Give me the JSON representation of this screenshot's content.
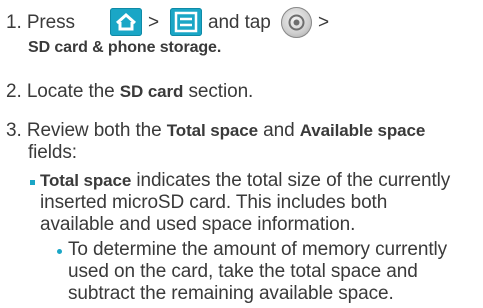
{
  "step1": {
    "number": "1.",
    "press": "Press",
    "sep1": ">",
    "and_tap": "and tap",
    "sep2": ">",
    "path": "SD card & phone storage."
  },
  "step2": {
    "number": "2.",
    "text_before": "Locate the",
    "bold": "SD card",
    "text_after": "section."
  },
  "step3": {
    "number": "3.",
    "text_a": "Review both the",
    "bold_a": "Total space",
    "text_b": "and",
    "bold_b": "Available space",
    "line2": "fields:"
  },
  "bullet1": {
    "bold": "Total space",
    "line1_rest": "indicates the total size of the currently",
    "line2": "inserted microSD card. This includes both",
    "line3": "available and used space information."
  },
  "subbullet": {
    "line1": "To determine the amount of memory currently",
    "line2": "used on the card, take the total space and",
    "line3": "subtract the remaining available space."
  },
  "icons": {
    "home": "home-icon",
    "menu": "menu-icon",
    "settings": "settings-gear-icon",
    "accent_color": "#1aa6c6"
  }
}
